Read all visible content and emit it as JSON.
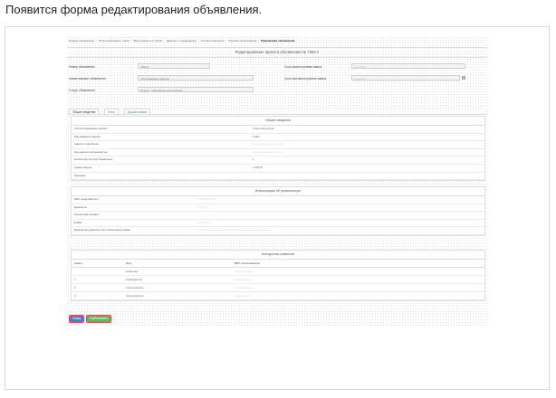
{
  "page": {
    "heading": "Появится форма редактирования объявления."
  },
  "breadcrumbs": [
    "Подача объявления",
    "Поиск выбранных типов",
    "Вход данных по типам",
    "Данные о поддержании",
    "Условия внесения",
    "Условия допуска/вида",
    "Публикация объявления"
  ],
  "form": {
    "title": "Редактирование проекта объявления № 7993-2",
    "left_fields": [
      {
        "label": "Номер объявления",
        "value": "7993-2"
      },
      {
        "label": "Наименование объявления",
        "value": "Оборудование камеры"
      },
      {
        "label": "Статус объявления",
        "value": "Проект · Изменение регистрации"
      }
    ],
    "right_fields": [
      {
        "label": "Срок начала приема заявок",
        "value": "xxxxxxxxxx"
      },
      {
        "label": "Срок окончания приема заявок",
        "value": "xxxxxxxxxx"
      }
    ]
  },
  "tabs": [
    "Общие сведения",
    "Лоты",
    "Документация"
  ],
  "general": {
    "title": "Общие сведения",
    "rows": [
      {
        "label": "Способ проведения закупки",
        "value": "Открытый конкурс",
        "blur": false
      },
      {
        "label": "Вид предмета закупки",
        "value": "Товар",
        "blur": false
      },
      {
        "label": "Адресат подписания",
        "value": "xxxxxxxxxxxxxxxxxxxxxxxxx",
        "blur": true
      },
      {
        "label": "Код единого соглашения на",
        "value": "xxxxxxxxxxxxxxxxxxxxxxx",
        "blur": true
      },
      {
        "label": "Количество лотов в объявлении",
        "value": "1",
        "blur": false
      },
      {
        "label": "Сумма закупки",
        "value": "1 000,00",
        "blur": false
      },
      {
        "label": "Признаки",
        "value": "",
        "blur": false
      }
    ]
  },
  "organizer": {
    "title": "Информация об организаторе",
    "rows": [
      {
        "label": "ФИО представителя",
        "value": "xxxxxxxxxxxxxx",
        "blur": true
      },
      {
        "label": "Должность",
        "value": "xxxxxxx",
        "blur": true
      },
      {
        "label": "Контактный телефон",
        "value": "",
        "blur": false
      },
      {
        "label": "E-Mail",
        "value": "xxxxxxxxxx",
        "blur": true
      },
      {
        "label": "Банковские реквизиты для обеспечения заявки",
        "value": "xxxxxxxxxxxxxxxxxxxxxxxxxxxxxxxxxxxxxxxxxxxxxxxxxxxxxxxx",
        "blur": true
      }
    ]
  },
  "commission": {
    "title": "Конкурсная комиссия",
    "headers": [
      "Номер",
      "Роль",
      "ФИО члена комиссии"
    ],
    "rows": [
      {
        "num": "",
        "role": "Секретарь",
        "name": "xxxxxxxxxxxxxx"
      },
      {
        "num": "1",
        "role": "Руководитель",
        "name": "xxxxxxxxxxxxx"
      },
      {
        "num": "2",
        "role": "Член комиссии",
        "name": "xxxxxxxxxxxxxx"
      },
      {
        "num": "3",
        "role": "Член комиссии",
        "name": "xxxxxxxxxxxx"
      }
    ]
  },
  "buttons": {
    "back": "Назад",
    "publish": "Опубликовать"
  }
}
